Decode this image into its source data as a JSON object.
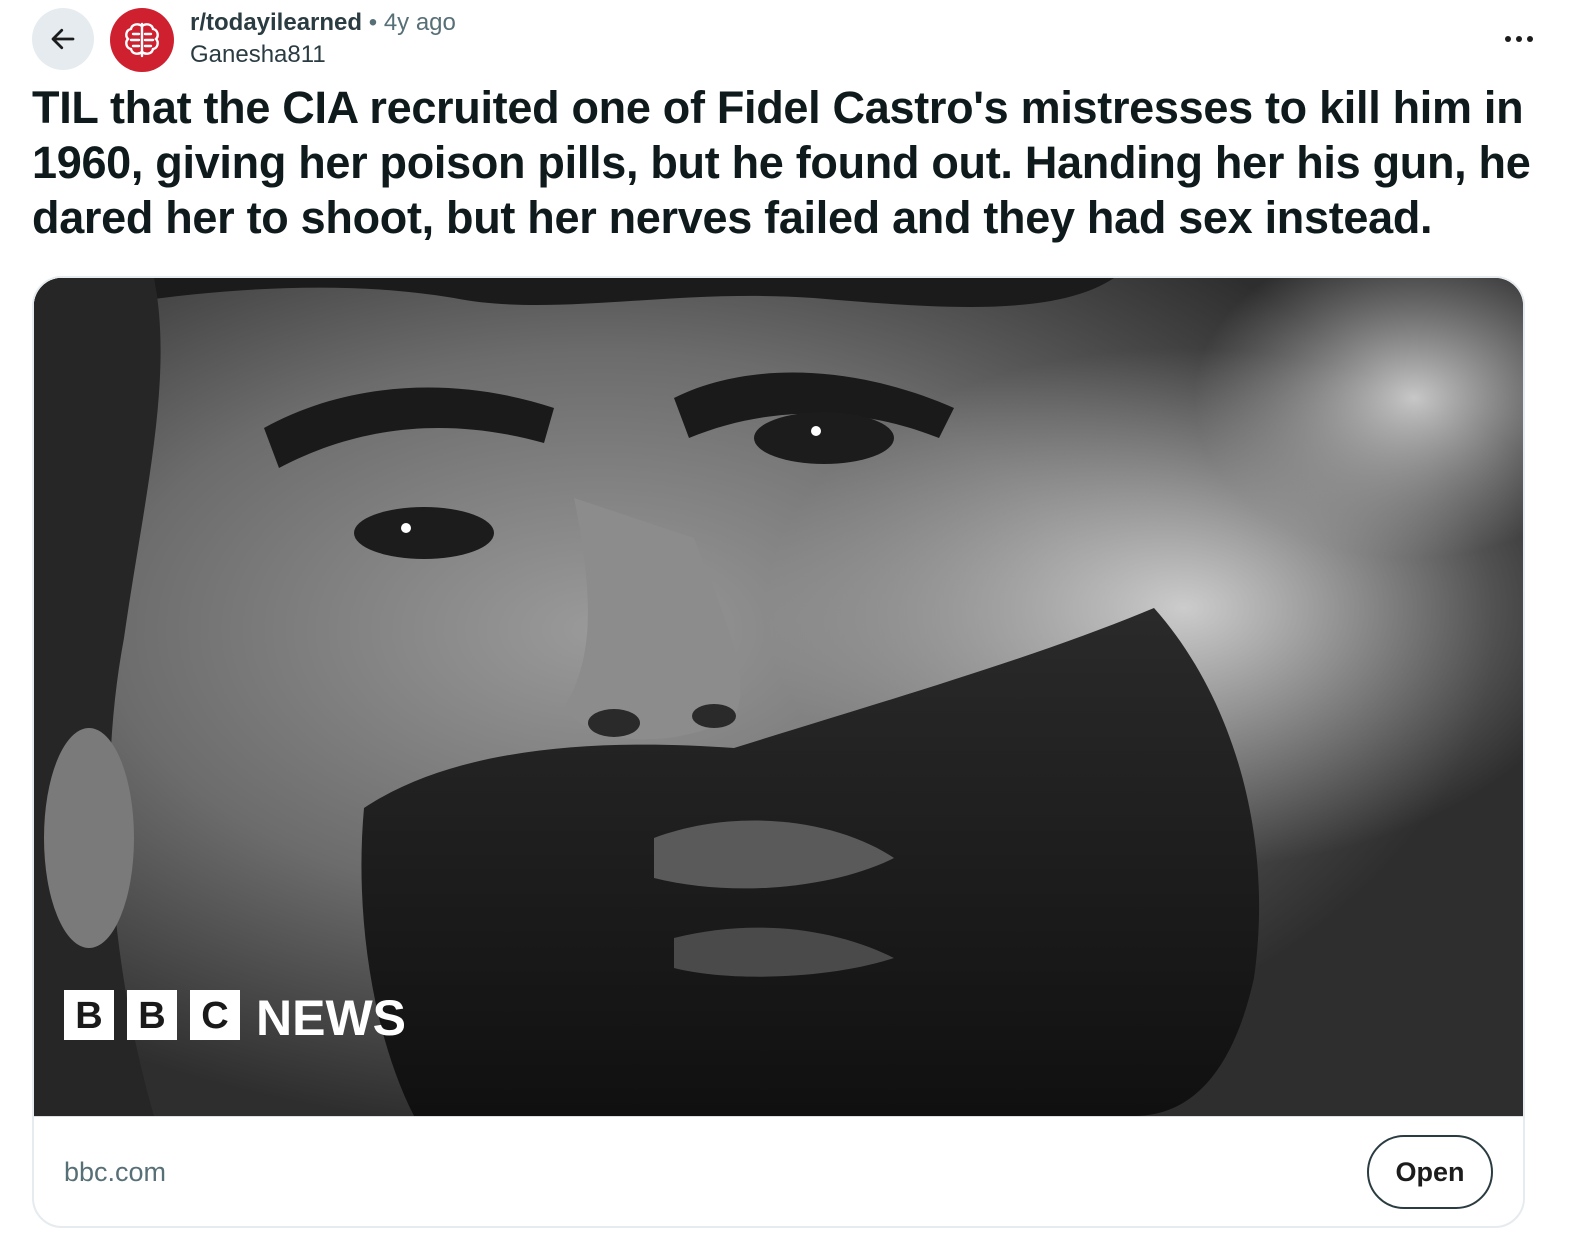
{
  "header": {
    "back_icon": "arrow-left-icon",
    "subreddit_icon": "brain-icon",
    "subreddit": "r/todayilearned",
    "separator": "•",
    "age": "4y ago",
    "author": "Ganesha811",
    "more_icon": "ellipsis-icon"
  },
  "post": {
    "title": "TIL that the CIA recruited one of Fidel Castro's mistresses to kill him in 1960, giving her poison pills, but he found out. Handing her his gun, he dared her to shoot, but her nerves failed and they had sex instead."
  },
  "link_card": {
    "logo_letters": [
      "B",
      "B",
      "C"
    ],
    "logo_word": "NEWS",
    "domain": "bbc.com",
    "open_label": "Open"
  },
  "colors": {
    "subreddit_avatar": "#cf2030",
    "back_button_bg": "#e5ebee",
    "meta_text": "#576f76",
    "title_text": "#0f1a1c"
  }
}
